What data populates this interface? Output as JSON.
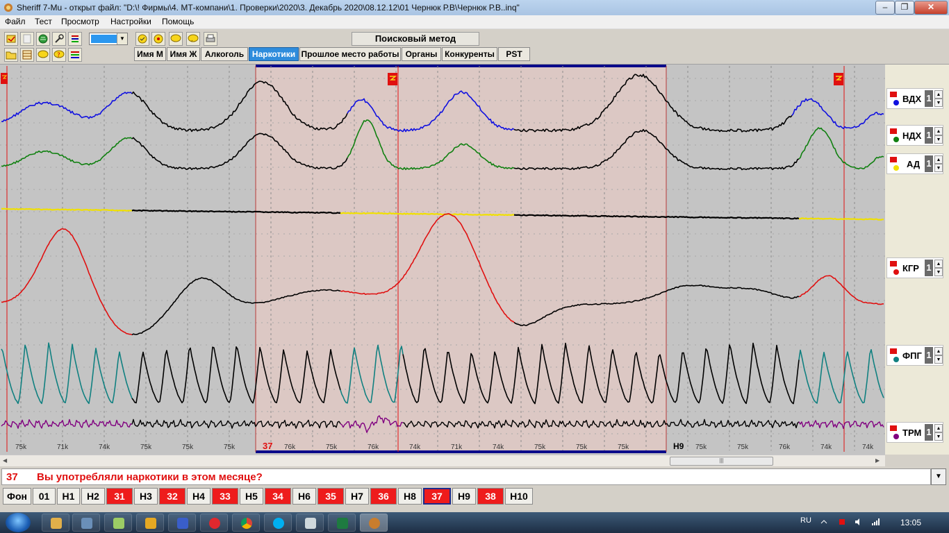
{
  "window": {
    "title": "Sheriff 7-Mu - открыт файл: \"D:\\! Фирмы\\4. МТ-компани\\1. Проверки\\2020\\3. Декабрь 2020\\08.12.12\\01 Чернюк Р.В\\Чернюк Р.В..inq\"",
    "minimize": "–",
    "restore": "❐",
    "close": "✕"
  },
  "menu": [
    "Файл",
    "Тест",
    "Просмотр",
    "Настройки",
    "Помощь"
  ],
  "toolbar": {
    "method_title": "Поисковый метод",
    "tabs": [
      "Имя М",
      "Имя Ж",
      "Алкоголь",
      "Наркотики",
      "Прошлое место работы",
      "Органы",
      "Конкуренты",
      "PST"
    ],
    "active_tab": "Наркотики",
    "color_swatch": "#2b97ef"
  },
  "channels": [
    {
      "name": "ВДХ",
      "value": "1",
      "color": "#1010e0"
    },
    {
      "name": "НДХ",
      "value": "1",
      "color": "#108010"
    },
    {
      "name": "АД",
      "value": "1",
      "color": "#f0e000"
    },
    {
      "name": "КГР",
      "value": "1",
      "color": "#e01010"
    },
    {
      "name": "ФПГ",
      "value": "1",
      "color": "#108080"
    },
    {
      "name": "ТРМ",
      "value": "1",
      "color": "#800080"
    }
  ],
  "chart_data": {
    "type": "line",
    "x_labels": [
      "75k",
      "71k",
      "74k",
      "75k",
      "75k",
      "75k",
      "76k",
      "75k",
      "76k",
      "74k",
      "71k",
      "74k",
      "75k",
      "75k",
      "75k",
      "75k",
      "75k",
      "76k",
      "74k",
      "74k"
    ],
    "question_markers": [
      "37",
      "H9"
    ],
    "highlight_range_label": "37",
    "colors": {
      "chart_bg": "#c4c4c4",
      "highlight_bg": "#dcc8c4",
      "marker": "#e01010",
      "highlight_border": "#0a0a8a"
    }
  },
  "question": {
    "number": "37",
    "text": "Вы употребляли наркотики в этом месяце?"
  },
  "question_buttons": [
    {
      "label": "Фон",
      "red": false
    },
    {
      "label": "01",
      "red": false
    },
    {
      "label": "H1",
      "red": false
    },
    {
      "label": "H2",
      "red": false
    },
    {
      "label": "31",
      "red": true
    },
    {
      "label": "H3",
      "red": false
    },
    {
      "label": "32",
      "red": true
    },
    {
      "label": "H4",
      "red": false
    },
    {
      "label": "33",
      "red": true
    },
    {
      "label": "H5",
      "red": false
    },
    {
      "label": "34",
      "red": true
    },
    {
      "label": "H6",
      "red": false
    },
    {
      "label": "35",
      "red": true
    },
    {
      "label": "H7",
      "red": false
    },
    {
      "label": "36",
      "red": true
    },
    {
      "label": "H8",
      "red": false
    },
    {
      "label": "37",
      "red": true,
      "current": true
    },
    {
      "label": "H9",
      "red": false
    },
    {
      "label": "38",
      "red": true
    },
    {
      "label": "H10",
      "red": false
    }
  ],
  "taskbar": {
    "lang": "RU",
    "time": "13:05"
  }
}
